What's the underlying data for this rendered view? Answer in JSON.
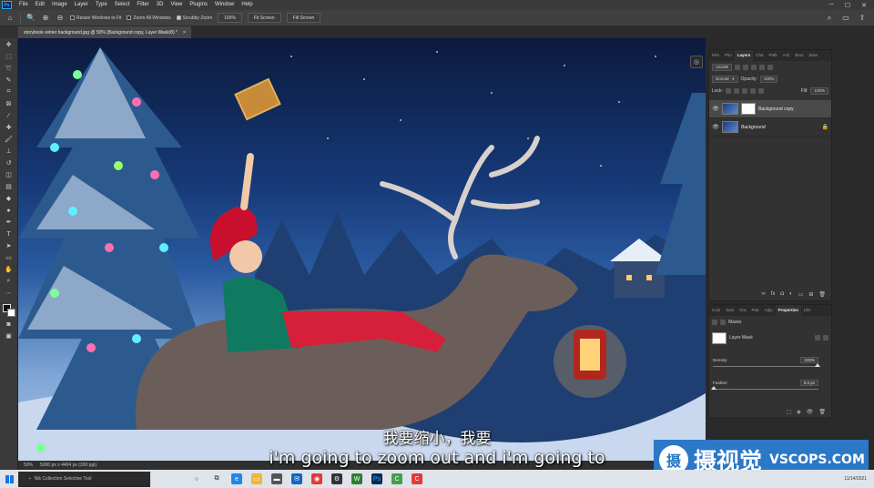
{
  "colors": {
    "accent": "#31a8ff",
    "watermark_bg": "#2b78c6",
    "panel_bg": "#323232"
  },
  "app": {
    "logo": "Ps"
  },
  "menu": [
    "File",
    "Edit",
    "Image",
    "Layer",
    "Type",
    "Select",
    "Filter",
    "3D",
    "View",
    "Plugins",
    "Window",
    "Help"
  ],
  "options": {
    "resize_windows": "Resize Windows to Fit",
    "zoom_all": "Zoom All Windows",
    "scrubby_zoom": "Scrubby Zoom",
    "zoom_value": "100%",
    "fit_screen": "Fit Screen",
    "fill_screen": "Fill Screen"
  },
  "document": {
    "tab_title": "storybook winter background.jpg @ 50% (Background copy, Layer Mask/8) *",
    "close": "×"
  },
  "status": {
    "zoom": "50%",
    "info": "5000 px x 4404 px (300 ppi)"
  },
  "layers_panel": {
    "tabs": [
      "Hist",
      "Pho",
      "Layers",
      "Cha",
      "Path",
      "Acti",
      "Brus",
      "Bras"
    ],
    "active_tab": "Layers",
    "filter": "Kind",
    "blend_mode": "Normal",
    "opacity_label": "Opacity:",
    "opacity_value": "100%",
    "lock_label": "Lock:",
    "fill_label": "Fill:",
    "fill_value": "100%",
    "layers": [
      {
        "name": "Background copy"
      },
      {
        "name": "Background"
      }
    ]
  },
  "properties_panel": {
    "tabs": [
      "Colo",
      "Swa",
      "Gra",
      "Patt",
      "Adju",
      "Properties",
      "Libr"
    ],
    "active_tab": "Properties",
    "section": "Masks",
    "mask_name": "Layer Mask",
    "density_label": "Density:",
    "density_value": "100%",
    "feather_label": "Feather:",
    "feather_value": "0.0 px"
  },
  "subtitles": {
    "cn": "我要缩小，我要",
    "en": "i'm going to zoom out and i'm going to"
  },
  "watermark": {
    "logo_char": "摄",
    "cn": "摄视觉",
    "en": "VSCOPS.COM"
  },
  "taskbar": {
    "search_text": "Nik Collection Selective Tool",
    "clock": "11/14/2021"
  }
}
